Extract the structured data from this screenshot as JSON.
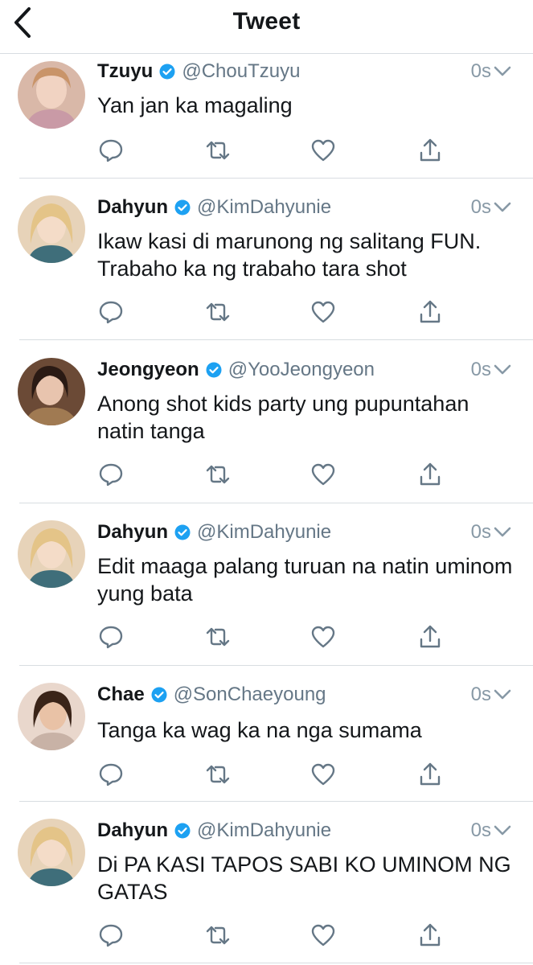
{
  "header": {
    "title": "Tweet"
  },
  "tweets": [
    {
      "name": "Tzuyu",
      "handle": "@ChouTzuyu",
      "time": "0s",
      "text": "Yan jan ka magaling"
    },
    {
      "name": "Dahyun",
      "handle": "@KimDahyunie",
      "time": "0s",
      "text": "Ikaw kasi di marunong ng salitang FUN. Trabaho ka ng trabaho tara shot"
    },
    {
      "name": "Jeongyeon",
      "handle": "@YooJeongyeon",
      "time": "0s",
      "text": "Anong shot kids party ung pupuntahan natin tanga"
    },
    {
      "name": "Dahyun",
      "handle": "@KimDahyunie",
      "time": "0s",
      "text": "Edit maaga palang turuan na natin uminom yung bata"
    },
    {
      "name": "Chae",
      "handle": "@SonChaeyoung",
      "time": "0s",
      "text": "Tanga ka wag ka na nga sumama"
    },
    {
      "name": "Dahyun",
      "handle": "@KimDahyunie",
      "time": "0s",
      "text": "Di PA KASI TAPOS SABI KO UMINOM NG GATAS"
    }
  ],
  "icons": {
    "back": "chevron-left-icon",
    "verified": "verified-badge-icon",
    "caret": "chevron-down-icon",
    "reply": "reply-icon",
    "retweet": "retweet-icon",
    "like": "heart-icon",
    "share": "share-icon"
  },
  "colors": {
    "verified": "#1da1f2",
    "icon": "#657786",
    "separator": "#d8dde1"
  }
}
